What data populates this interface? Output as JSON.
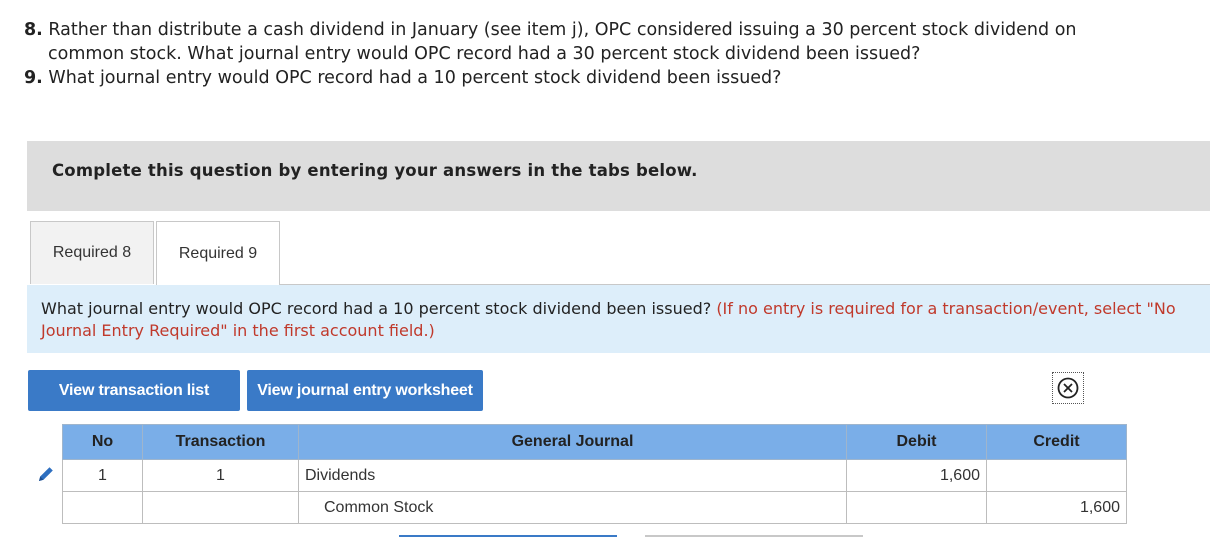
{
  "questions": [
    {
      "num": "8.",
      "line1": "Rather than distribute a cash dividend in January (see item j), OPC considered issuing a 30 percent stock dividend on",
      "line2": "common stock. What journal entry would OPC record had a 30 percent stock dividend been issued?"
    },
    {
      "num": "9.",
      "line1": "What journal entry would OPC record had a 10 percent stock dividend been issued?"
    }
  ],
  "instruction": "Complete this question by entering your answers in the tabs below.",
  "tabs": [
    {
      "label": "Required 8",
      "active": false
    },
    {
      "label": "Required 9",
      "active": true
    }
  ],
  "prompt": {
    "main": "What journal entry would OPC record had a 10 percent stock dividend been issued?",
    "note": "(If no entry is required for a transaction/event, select \"No Journal Entry Required\" in the first account field.)"
  },
  "buttons": {
    "view_list": "View transaction list",
    "view_worksheet": "View journal entry worksheet"
  },
  "table": {
    "headers": {
      "no": "No",
      "transaction": "Transaction",
      "general_journal": "General Journal",
      "debit": "Debit",
      "credit": "Credit"
    },
    "rows": [
      {
        "no": "1",
        "transaction": "1",
        "account": "Dividends",
        "debit": "1,600",
        "credit": ""
      },
      {
        "no": "",
        "transaction": "",
        "account": "Common Stock",
        "debit": "",
        "credit": "1,600"
      }
    ]
  },
  "colors": {
    "accent": "#3a7ac7",
    "header_bg": "#7aaee8",
    "note_red": "#c0392b",
    "prompt_bg": "#ddeefa"
  },
  "icons": [
    "close-icon",
    "pencil-icon"
  ]
}
